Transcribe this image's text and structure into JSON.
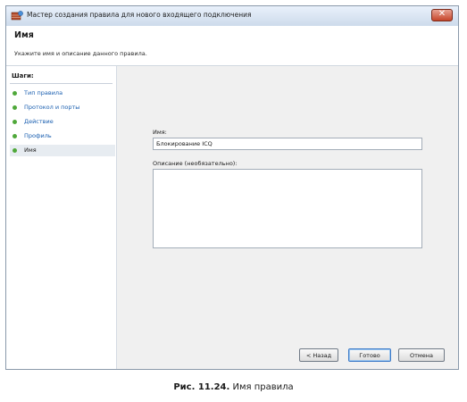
{
  "window": {
    "title": "Мастер создания правила для нового входящего подключения",
    "close_label": "✕"
  },
  "header": {
    "title": "Имя",
    "subtitle": "Укажите имя и описание данного правила."
  },
  "steps": {
    "title": "Шаги:",
    "items": [
      {
        "label": "Тип правила"
      },
      {
        "label": "Протокол и порты"
      },
      {
        "label": "Действие"
      },
      {
        "label": "Профиль"
      },
      {
        "label": "Имя"
      }
    ]
  },
  "form": {
    "name_label": "Имя:",
    "name_value": "Блокирование ICQ",
    "description_label": "Описание (необязательно):",
    "description_value": ""
  },
  "buttons": {
    "back": "< Назад",
    "finish": "Готово",
    "cancel": "Отмена"
  },
  "caption": {
    "number": "Рис. 11.24.",
    "text": " Имя правила"
  },
  "colors": {
    "step_dot": "#4fa83a",
    "link": "#1a5fb0",
    "close_button": "#c6452a"
  }
}
